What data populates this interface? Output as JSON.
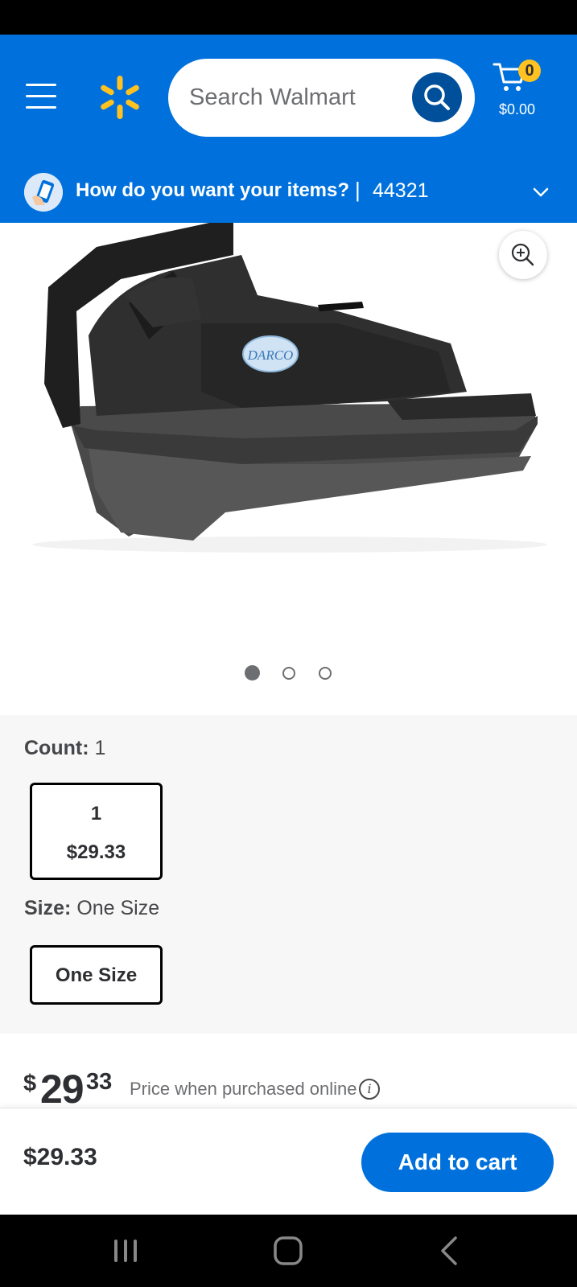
{
  "header": {
    "search_placeholder": "Search Walmart",
    "cart_count": "0",
    "cart_total": "$0.00",
    "brand_color": "#0071dc",
    "spark_color": "#ffc220"
  },
  "delivery": {
    "question": "How do you want your items?",
    "separator": "|",
    "zip": "44321"
  },
  "gallery": {
    "image_count": 3,
    "active_index": 0
  },
  "variants": {
    "count": {
      "label": "Count:",
      "value": "1",
      "options": [
        {
          "title": "1",
          "price": "$29.33",
          "selected": true
        }
      ]
    },
    "size": {
      "label": "Size:",
      "value": "One Size",
      "options": [
        {
          "title": "One Size",
          "selected": true
        }
      ]
    }
  },
  "price": {
    "currency": "$",
    "whole": "29",
    "cents": "33",
    "note": "Price when purchased online",
    "info_icon": "i"
  },
  "bottom_bar": {
    "price": "$29.33",
    "add_to_cart_label": "Add to cart"
  }
}
